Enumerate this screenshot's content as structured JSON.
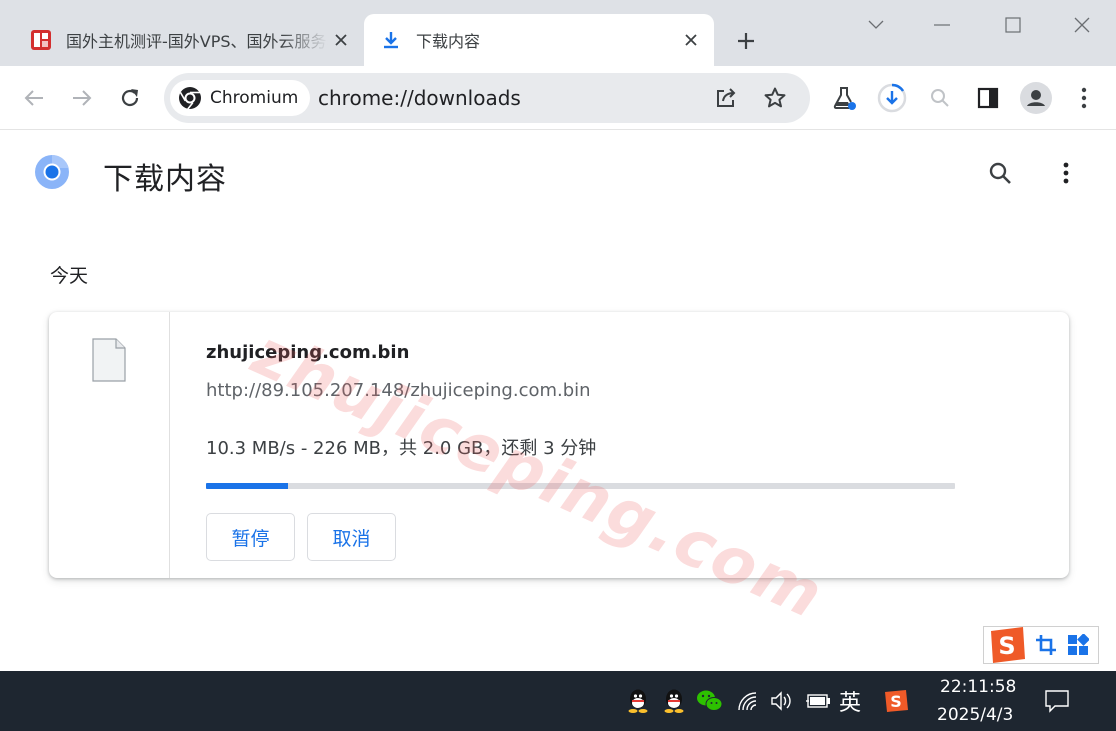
{
  "tabs": [
    {
      "title": "国外主机测评-国外VPS、国外云服务器",
      "favicon": "zhujiceping-favicon"
    },
    {
      "title": "下载内容",
      "favicon": "download-icon"
    }
  ],
  "toolbar": {
    "chip_label": "Chromium",
    "url": "chrome://downloads"
  },
  "page": {
    "title": "下载内容",
    "date_header": "今天"
  },
  "download": {
    "file_name": "zhujiceping.com.bin",
    "url": "http://89.105.207.148/zhujiceping.com.bin",
    "status": "10.3 MB/s - 226 MB，共 2.0 GB，还剩 3 分钟",
    "progress_percent": 11,
    "pause_label": "暂停",
    "cancel_label": "取消"
  },
  "watermark": "zhujiceping.com",
  "taskbar": {
    "ime_lang": "英",
    "time": "22:11:58",
    "date": "2025/4/3"
  },
  "colors": {
    "accent": "#1a73e8",
    "tabstrip": "#dee1e6",
    "taskbar": "#1e2630"
  }
}
